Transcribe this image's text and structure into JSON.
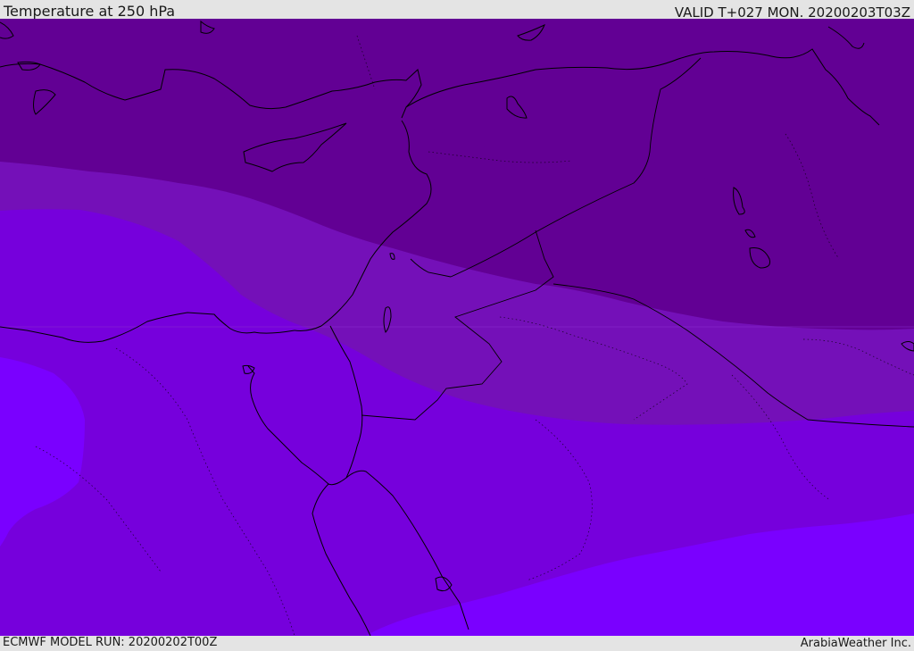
{
  "header": {
    "title": "Temperature at 250 hPa",
    "valid_time": "VALID T+027 MON. 20200203T03Z"
  },
  "footer": {
    "model_run": "ECMWF MODEL RUN: 20200202T00Z",
    "credit": "ArabiaWeather Inc."
  },
  "map": {
    "field": "temperature",
    "level": "250 hPa",
    "bands": [
      {
        "name": "band-coldest",
        "color": "#4d0078"
      },
      {
        "name": "band-cold",
        "color": "#620094"
      },
      {
        "name": "band-mid",
        "color": "#7410b8"
      },
      {
        "name": "band-warm",
        "color": "#7600dc"
      },
      {
        "name": "band-warmest",
        "color": "#7a00ff"
      }
    ],
    "coastline_color": "#000000",
    "border_style": "dotted"
  }
}
